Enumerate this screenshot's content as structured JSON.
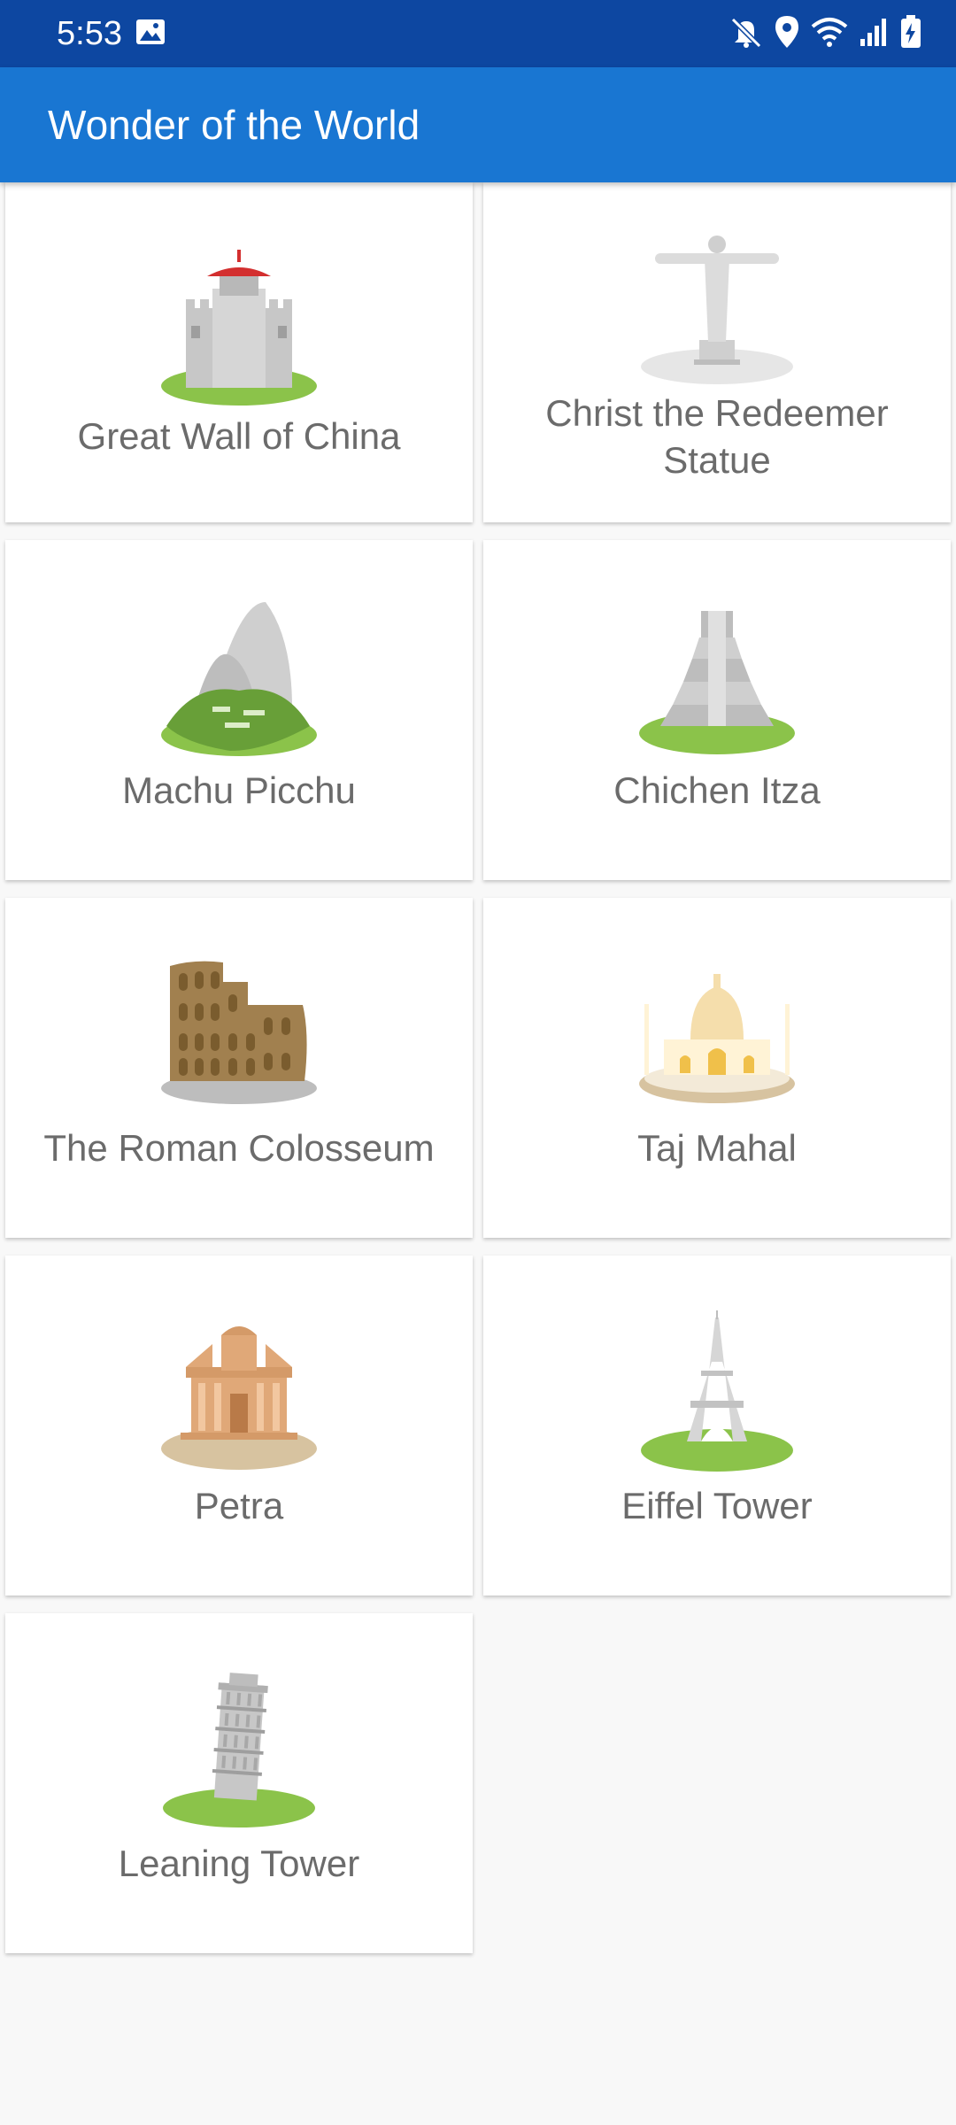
{
  "status_bar": {
    "time": "5:53",
    "icons": [
      "gallery-icon",
      "mute-icon",
      "location-icon",
      "wifi-icon",
      "signal-icon",
      "battery-icon"
    ]
  },
  "app_bar": {
    "title": "Wonder of the World"
  },
  "colors": {
    "status_bar": "#0d47a1",
    "app_bar": "#1976d2",
    "background": "#f8f8f8",
    "card": "#ffffff",
    "label": "#6b6b6b"
  },
  "wonders": [
    {
      "name": "Great Wall of China",
      "icon": "great-wall-icon"
    },
    {
      "name": "Christ the Redeemer Statue",
      "icon": "christ-redeemer-icon"
    },
    {
      "name": "Machu Picchu",
      "icon": "machu-picchu-icon"
    },
    {
      "name": "Chichen Itza",
      "icon": "chichen-itza-icon"
    },
    {
      "name": "The Roman Colosseum",
      "icon": "colosseum-icon"
    },
    {
      "name": "Taj Mahal",
      "icon": "taj-mahal-icon"
    },
    {
      "name": "Petra",
      "icon": "petra-icon"
    },
    {
      "name": "Eiffel Tower",
      "icon": "eiffel-tower-icon"
    },
    {
      "name": "Leaning Tower",
      "icon": "leaning-tower-icon"
    }
  ]
}
